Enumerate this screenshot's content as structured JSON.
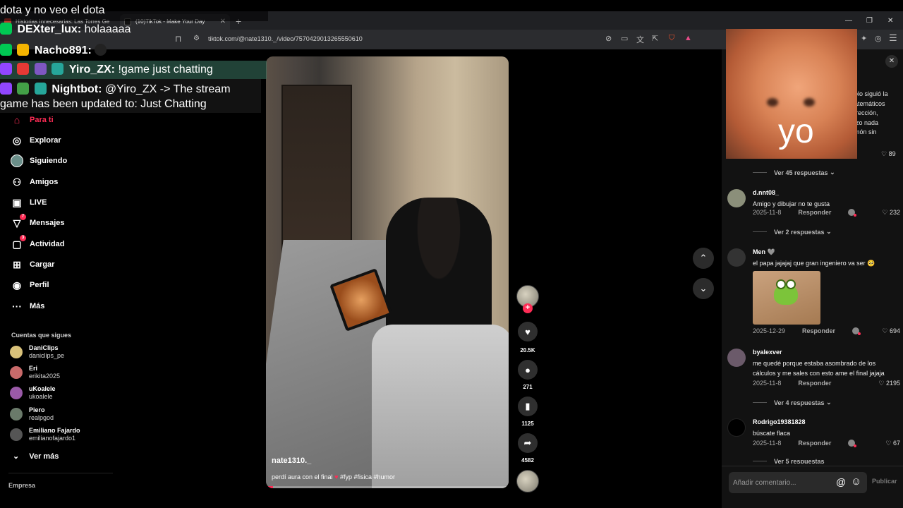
{
  "browser": {
    "tabs": [
      {
        "label": "Historias Innecesarias: Las Torres Ge",
        "active": false
      },
      {
        "label": "(10)TikTok - Make Your Day",
        "active": true
      }
    ],
    "url": "tiktok.com/@nate1310._/video/7570429013265550610"
  },
  "nav": {
    "items": [
      {
        "label": "Para ti",
        "icon": "home-icon",
        "active": true
      },
      {
        "label": "Explorar",
        "icon": "compass-icon"
      },
      {
        "label": "Siguiendo",
        "icon": "following-avatar-icon"
      },
      {
        "label": "Amigos",
        "icon": "friends-icon"
      },
      {
        "label": "LIVE",
        "icon": "live-icon"
      },
      {
        "label": "Mensajes",
        "icon": "messages-icon",
        "badge": "7"
      },
      {
        "label": "Actividad",
        "icon": "activity-icon",
        "badge": "3"
      },
      {
        "label": "Cargar",
        "icon": "upload-icon"
      },
      {
        "label": "Perfil",
        "icon": "profile-icon"
      },
      {
        "label": "Más",
        "icon": "more-icon"
      }
    ],
    "following_header": "Cuentas que sigues",
    "following": [
      {
        "name": "DaniClips",
        "handle": "daniclips_pe"
      },
      {
        "name": "Eri",
        "handle": "erikita2025"
      },
      {
        "name": "uKoalele",
        "handle": "ukoalele"
      },
      {
        "name": "Piero",
        "handle": "realpgod"
      },
      {
        "name": "Emiliano Fajardo",
        "handle": "emilianofajardo1"
      }
    ],
    "see_more": "Ver más",
    "footer": "Empresa"
  },
  "chat": {
    "lines": [
      {
        "user": "",
        "text": "dota y no veo el dota"
      },
      {
        "user": "DEXter_lux:",
        "text": "holaaaaa"
      },
      {
        "user": "Nacho891:",
        "text": ""
      },
      {
        "user": "Yiro_ZX:",
        "text": "!game just chatting"
      },
      {
        "user": "Nightbot:",
        "text": "@Yiro_ZX -> The stream"
      },
      {
        "user": "",
        "text": "game has been updated to: Just Chatting"
      }
    ]
  },
  "video": {
    "author": "nate1310._",
    "caption_pre": "perdí aura con el final",
    "caption_tags": "#fyp #fisica #humor",
    "progress": 0.03
  },
  "actions": {
    "likes": "20.5K",
    "comments": "271",
    "saves": "1125",
    "shares": "4582"
  },
  "comments_panel": {
    "partial_lines": [
      "olo siguió la",
      "atemáticos",
      "irección,",
      "izo nada",
      "món sin"
    ],
    "partial_likes": "89",
    "reply_links": [
      "Ver 45 respuestas",
      "Ver 2 respuestas",
      "Ver 4 respuestas",
      "Ver 5 respuestas"
    ],
    "items": [
      {
        "user": "d.nnt08_",
        "text": "Amigo y dibujar no te gusta",
        "date": "2025-11-8",
        "reply": "Responder",
        "likes": "232"
      },
      {
        "user": "Men 🩶",
        "text": "el papa jajajaj que gran ingeniero va ser 🥺",
        "date": "2025-12-29",
        "reply": "Responder",
        "likes": "694"
      },
      {
        "user": "byalexver",
        "text": "me quedé porque estaba asombrado de los cálculos y me sales con esto ame el final jajaja",
        "date": "2025-11-8",
        "reply": "Responder",
        "likes": "2195"
      },
      {
        "user": "Rodrigo19381828",
        "text": "búscate flaca",
        "date": "2025-11-8",
        "reply": "Responder",
        "likes": "67"
      }
    ],
    "input_placeholder": "Añadir comentario...",
    "publish": "Publicar"
  },
  "webcam": {
    "caption": "yo"
  }
}
